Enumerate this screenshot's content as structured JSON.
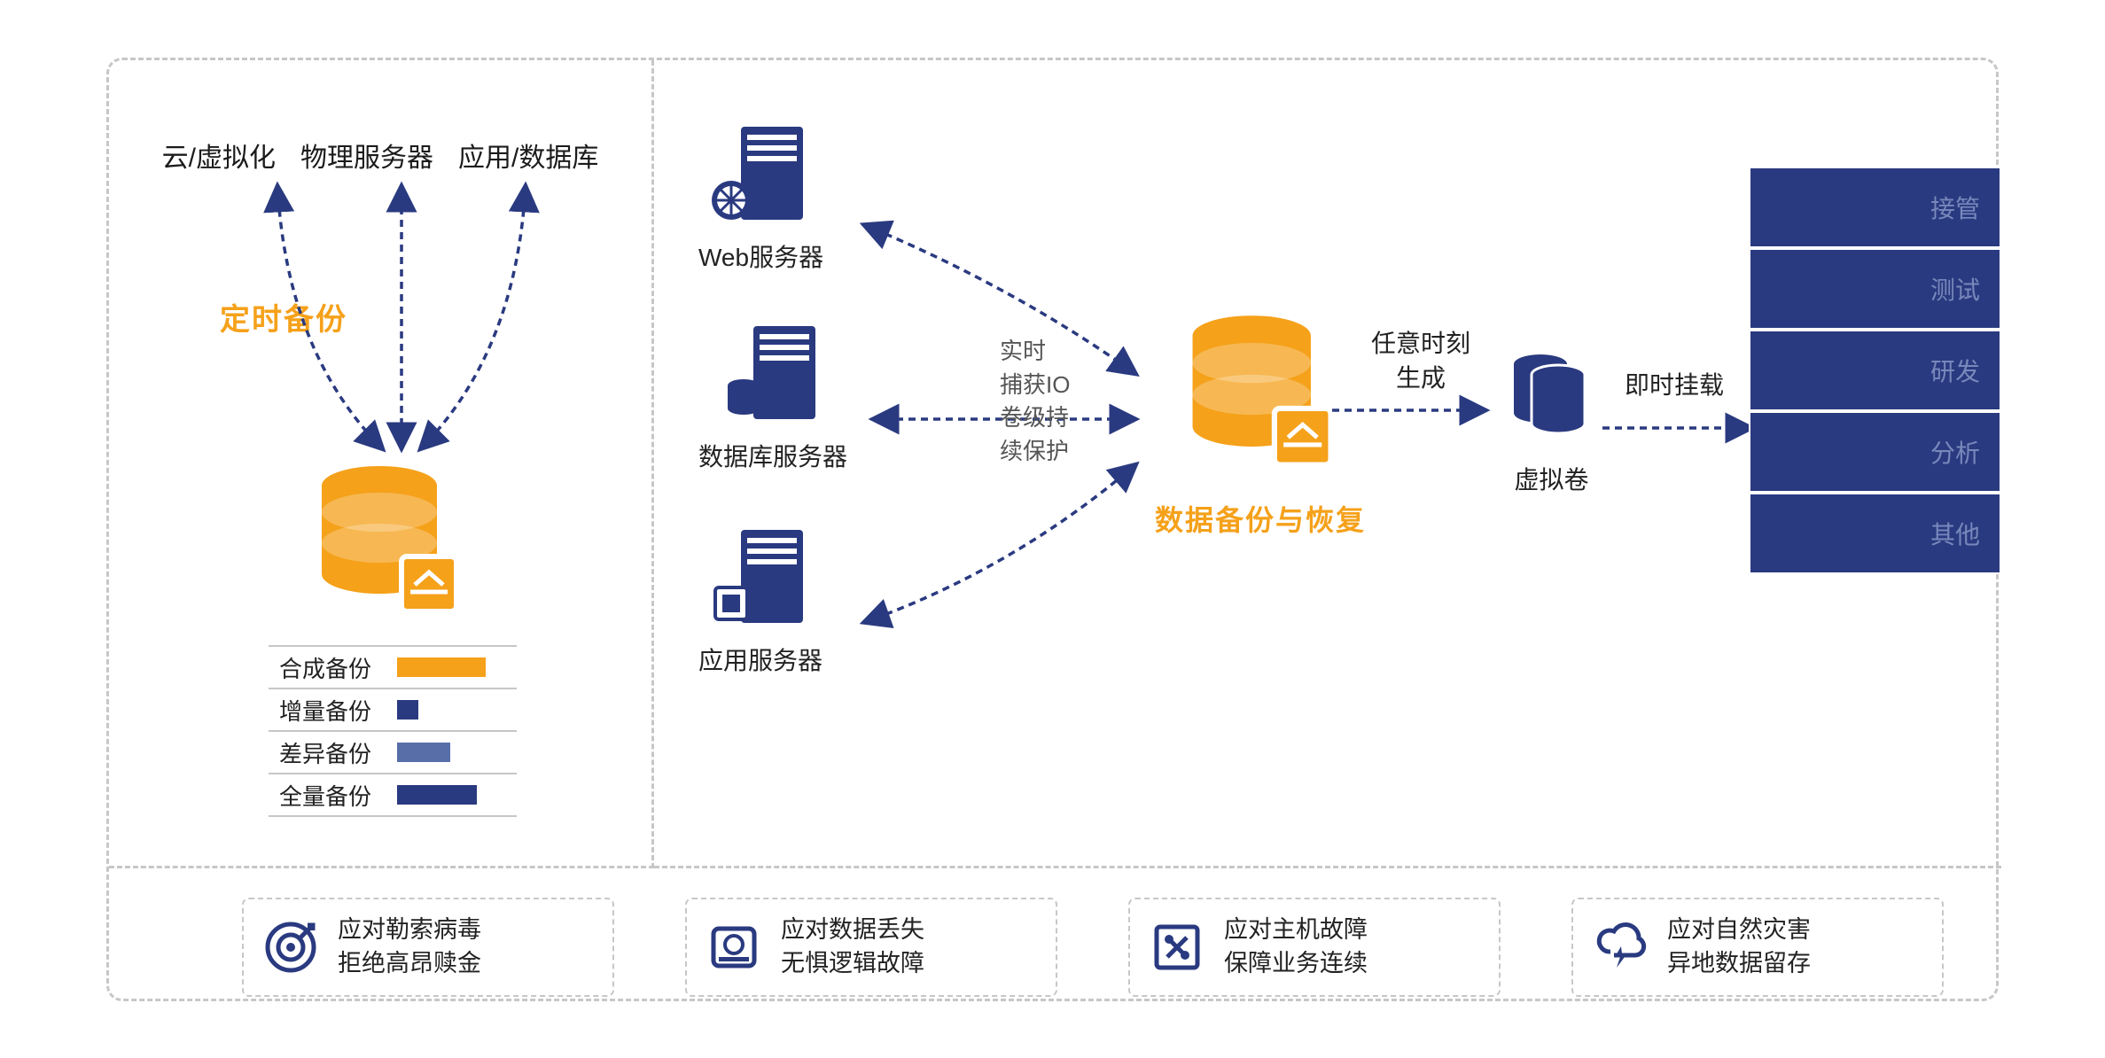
{
  "left": {
    "sources": [
      "云/虚拟化",
      "物理服务器",
      "应用/数据库"
    ],
    "title": "定时备份",
    "legend": [
      {
        "label": "合成备份",
        "color": "orange",
        "size": "l"
      },
      {
        "label": "增量备份",
        "color": "navy",
        "size": "s"
      },
      {
        "label": "差异备份",
        "color": "navy-mid",
        "size": "m"
      },
      {
        "label": "全量备份",
        "color": "navy",
        "size": "l"
      }
    ]
  },
  "right": {
    "servers": [
      "Web服务器",
      "数据库服务器",
      "应用服务器"
    ],
    "flow1_lines": [
      "实时",
      "捕获IO",
      "卷级持",
      "续保护"
    ],
    "center_title": "数据备份与恢复",
    "flow2": "任意时刻生成",
    "volume_label": "虚拟卷",
    "mount_label": "即时挂载",
    "targets": [
      "接管",
      "测试",
      "研发",
      "分析",
      "其他"
    ]
  },
  "features": [
    {
      "line1": "应对勒索病毒",
      "line2": "拒绝高昂赎金"
    },
    {
      "line1": "应对数据丢失",
      "line2": "无惧逻辑故障"
    },
    {
      "line1": "应对主机故障",
      "line2": "保障业务连续"
    },
    {
      "line1": "应对自然灾害",
      "line2": "异地数据留存"
    }
  ]
}
